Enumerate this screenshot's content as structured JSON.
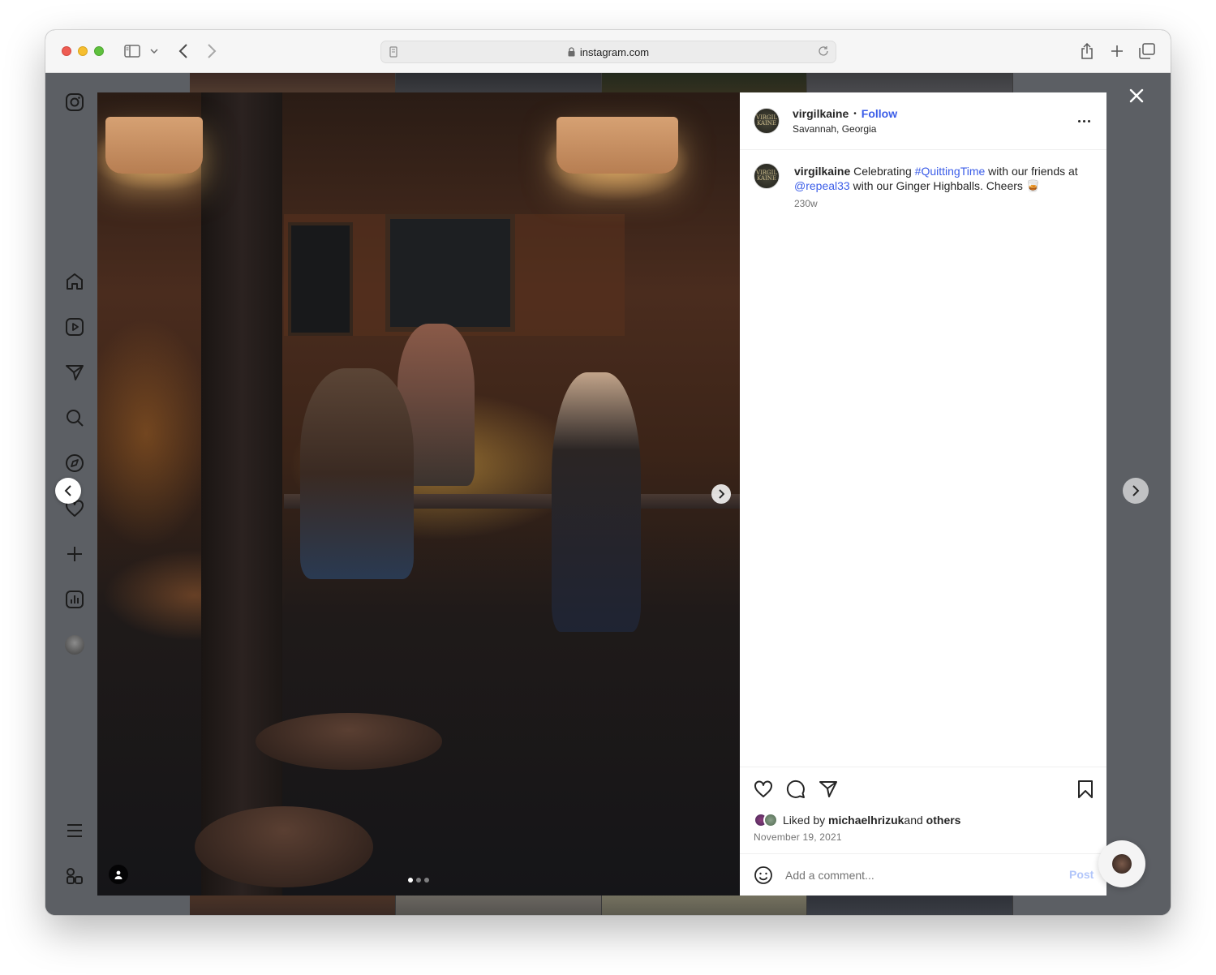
{
  "browser": {
    "url": "instagram.com"
  },
  "sidebar": {
    "items": [
      {
        "icon": "instagram-logo-icon"
      },
      {
        "icon": "home-icon"
      },
      {
        "icon": "reels-icon"
      },
      {
        "icon": "direct-messages-icon"
      },
      {
        "icon": "search-icon"
      },
      {
        "icon": "explore-icon"
      },
      {
        "icon": "notifications-heart-icon"
      },
      {
        "icon": "create-plus-icon"
      },
      {
        "icon": "insights-icon"
      },
      {
        "icon": "profile-avatar"
      },
      {
        "icon": "menu-icon"
      },
      {
        "icon": "also-from-meta-icon"
      }
    ]
  },
  "post": {
    "username": "virgilkaine",
    "follow_label": "Follow",
    "separator": "•",
    "location": "Savannah, Georgia",
    "avatar_text": "VIRGIL KAINE",
    "caption": {
      "username": "virgilkaine",
      "text_1": " Celebrating ",
      "hashtag": "#QuittingTime",
      "text_2": " with our friends at ",
      "mention": "@repeal33",
      "text_3": " with our Ginger Highballs. Cheers ",
      "emoji": "🥃",
      "age": "230w"
    },
    "likes": {
      "prefix": "Liked by ",
      "user": "michaelhrizuk",
      "middle": " and ",
      "others": "others"
    },
    "date": "November 19, 2021",
    "comment": {
      "placeholder": "Add a comment...",
      "post_label": "Post"
    },
    "carousel": {
      "count": 3,
      "active_index": 0
    }
  },
  "colors": {
    "link": "#3b5de8",
    "post_disabled": "#b2c6fa",
    "overlay": "#5c5f64"
  }
}
